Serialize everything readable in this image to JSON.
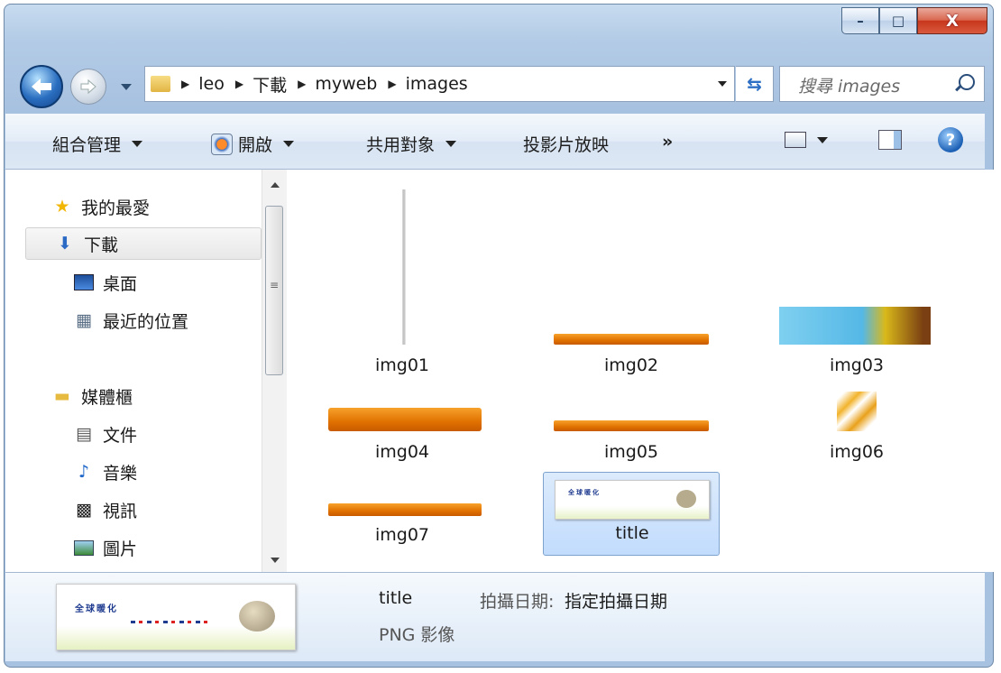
{
  "window": {
    "caption_min": "–",
    "caption_max": "□",
    "caption_close": "X"
  },
  "address": {
    "crumbs": [
      "leo",
      "下載",
      "myweb",
      "images"
    ]
  },
  "search": {
    "placeholder": "搜尋 images"
  },
  "toolbar": {
    "organize": "組合管理",
    "open": "開啟",
    "share": "共用對象",
    "slideshow": "投影片放映",
    "more": "»"
  },
  "nav": {
    "favorites": "我的最愛",
    "downloads": "下載",
    "desktop": "桌面",
    "recent": "最近的位置",
    "libraries": "媒體櫃",
    "documents": "文件",
    "music": "音樂",
    "videos": "視訊",
    "pictures": "圖片"
  },
  "files": [
    {
      "name": "img01"
    },
    {
      "name": "img02"
    },
    {
      "name": "img03"
    },
    {
      "name": "img04"
    },
    {
      "name": "img05"
    },
    {
      "name": "img06"
    },
    {
      "name": "img07"
    },
    {
      "name": "title"
    }
  ],
  "details": {
    "name": "title",
    "date_label": "拍攝日期:",
    "date_value": "指定拍攝日期",
    "type": "PNG 影像"
  },
  "preview_text": "全球暖化",
  "colors": {
    "selection": "#cce0fc",
    "accent_orange": "#e07100"
  }
}
